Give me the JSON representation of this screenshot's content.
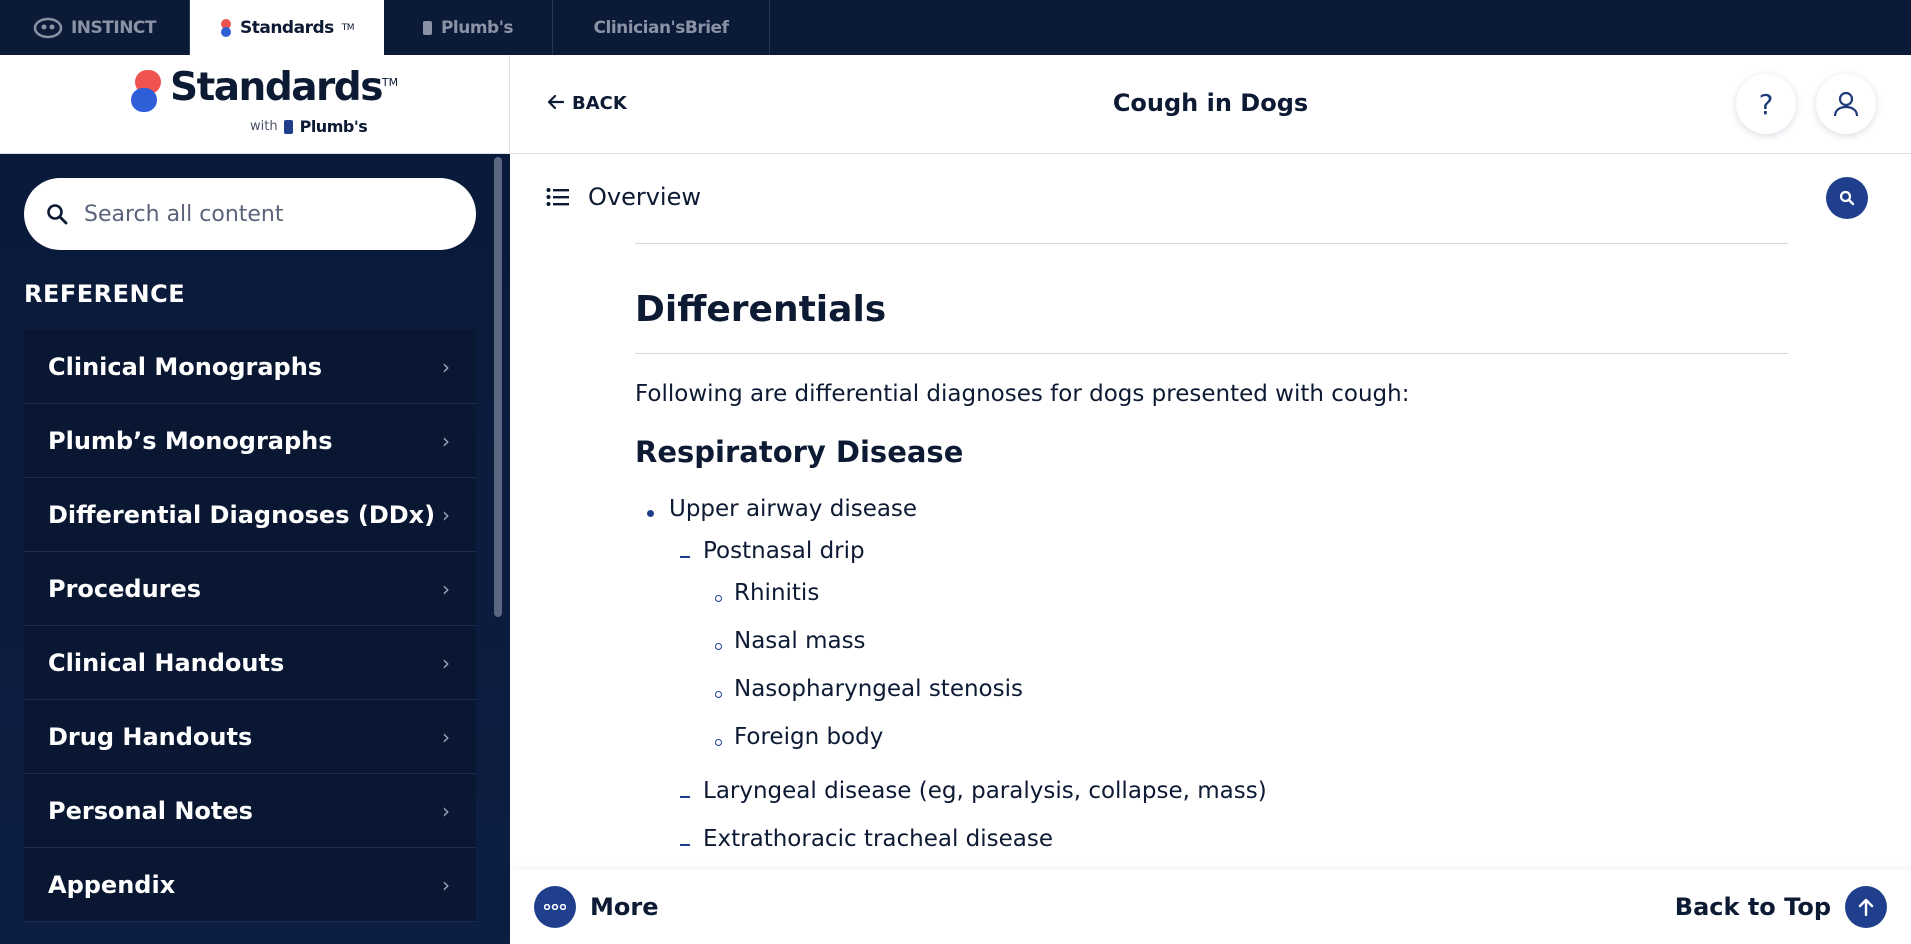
{
  "product_tabs": [
    {
      "label": "INSTINCT",
      "icon": "instinct-logo-icon",
      "active": false
    },
    {
      "label": "Standards",
      "icon": "standards-logo-icon",
      "active": true
    },
    {
      "label": "Plumb's",
      "icon": "plumbs-logo-icon",
      "active": false
    },
    {
      "label": "Clinician'sBrief",
      "icon": "",
      "active": false
    }
  ],
  "logo": {
    "wordmark": "Standards",
    "trademark": "TM",
    "with_label": "with",
    "partner": "Plumb's"
  },
  "header": {
    "back_label": "BACK",
    "title": "Cough in Dogs",
    "help_label": "?"
  },
  "sidebar": {
    "search_placeholder": "Search all content",
    "section_heading": "REFERENCE",
    "items": [
      {
        "label": "Clinical Monographs"
      },
      {
        "label": "Plumb’s Monographs"
      },
      {
        "label": "Differential Diagnoses (DDx)"
      },
      {
        "label": "Procedures"
      },
      {
        "label": "Clinical Handouts"
      },
      {
        "label": "Drug Handouts"
      },
      {
        "label": "Personal Notes"
      },
      {
        "label": "Appendix"
      }
    ]
  },
  "overview": {
    "label": "Overview"
  },
  "content": {
    "heading": "Differentials",
    "intro": "Following are differential diagnoses for dogs presented with cough:",
    "subheading": "Respiratory Disease",
    "list": {
      "l1_0": "Upper airway disease",
      "l2_0": "Postnasal drip",
      "l3_0": "Rhinitis",
      "l3_1": "Nasal mass",
      "l3_2": "Nasopharyngeal stenosis",
      "l3_3": "Foreign body",
      "l2_1": "Laryngeal disease (eg, paralysis, collapse, mass)",
      "l2_2": "Extrathoracic tracheal disease"
    }
  },
  "footer": {
    "more_label": "More",
    "back_to_top_label": "Back to Top"
  },
  "colors": {
    "navy": "#0b1a36",
    "accent_blue": "#1f3e8c",
    "text": "#0c1a33"
  }
}
